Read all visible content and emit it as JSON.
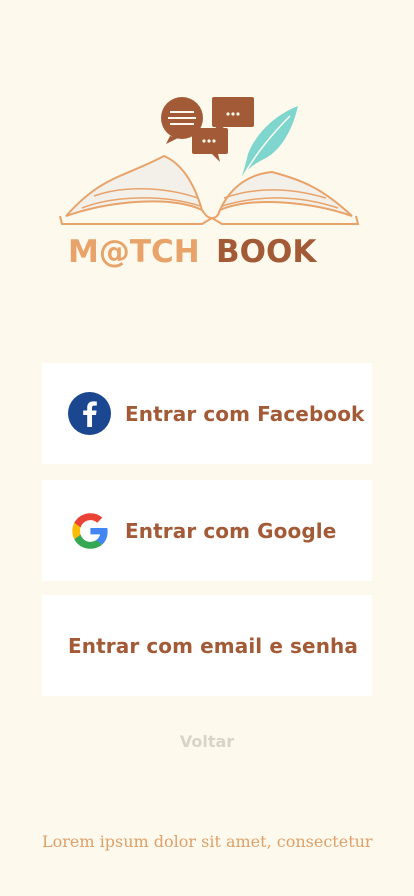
{
  "logo": {
    "word1": "M@TCH",
    "word2": "BOOK",
    "icon": "open-book-chat-quill-logo"
  },
  "buttons": {
    "facebook": {
      "label": "Entrar com Facebook",
      "icon": "facebook-icon"
    },
    "google": {
      "label": "Entrar com Google",
      "icon": "google-icon"
    },
    "email": {
      "label": "Entrar com email e senha"
    }
  },
  "back_label": "Voltar",
  "footer_text": "Lorem ipsum dolor sit amet, consectetur",
  "colors": {
    "background": "#fdf9ec",
    "brand_brown": "#a35a36",
    "brand_orange": "#e8a36a",
    "teal": "#7ed6cf",
    "facebook_blue": "#1b4790"
  }
}
